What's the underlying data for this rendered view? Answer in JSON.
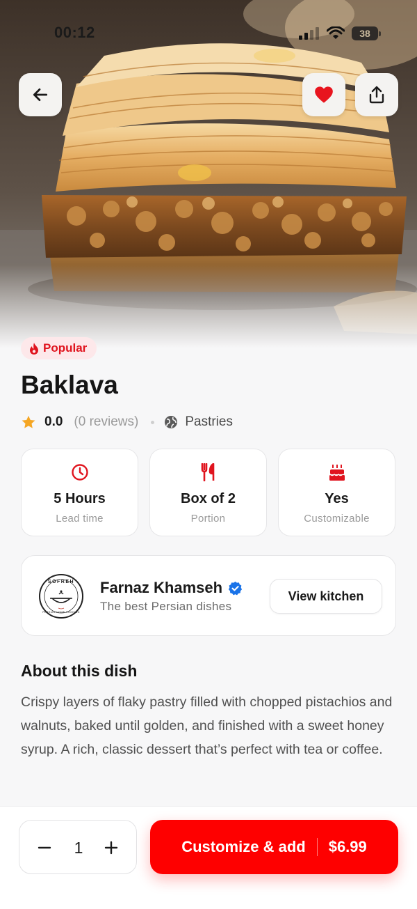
{
  "status_bar": {
    "time": "00:12",
    "battery": "38"
  },
  "hero": {
    "image_subject": "baklava-photo",
    "back_icon": "arrow-left-icon",
    "favorite_icon": "heart-icon",
    "share_icon": "share-icon"
  },
  "dish": {
    "badge": "Popular",
    "badge_icon": "flame-icon",
    "title": "Baklava",
    "rating": "0.0",
    "reviews": "(0 reviews)",
    "category": "Pastries"
  },
  "info_cards": [
    {
      "icon": "clock-icon",
      "value": "5 Hours",
      "label": "Lead time"
    },
    {
      "icon": "utensils-icon",
      "value": "Box of 2",
      "label": "Portion"
    },
    {
      "icon": "cake-icon",
      "value": "Yes",
      "label": "Customizable"
    }
  ],
  "kitchen": {
    "chef_name": "Farnaz Khamseh",
    "subtitle": "The best Persian dishes",
    "button_label": "View kitchen",
    "logo_text": "SOFREH",
    "logo_subtext": "PERSIAN HOME COOKING"
  },
  "about": {
    "title": "About this dish",
    "text": "Crispy layers of flaky pastry filled with chopped pistachios and walnuts, baked until golden, and finished with a sweet honey syrup. A rich, classic dessert that’s perfect with tea or coffee."
  },
  "cart": {
    "quantity": "1",
    "add_label": "Customize & add",
    "price": "$6.99"
  },
  "colors": {
    "accent": "#fe0000",
    "badge_bg": "#fde8ea",
    "star": "#f5a623",
    "verified": "#1a73e8"
  }
}
